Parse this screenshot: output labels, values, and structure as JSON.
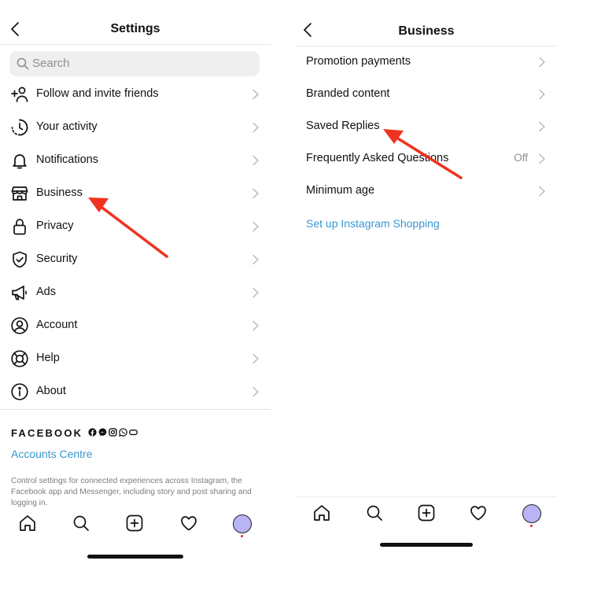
{
  "left": {
    "title": "Settings",
    "search_placeholder": "Search",
    "items": [
      {
        "label": "Follow and invite friends",
        "icon": "add-person-icon"
      },
      {
        "label": "Your activity",
        "icon": "activity-clock-icon"
      },
      {
        "label": "Notifications",
        "icon": "bell-icon"
      },
      {
        "label": "Business",
        "icon": "shop-icon"
      },
      {
        "label": "Privacy",
        "icon": "lock-icon"
      },
      {
        "label": "Security",
        "icon": "shield-check-icon"
      },
      {
        "label": "Ads",
        "icon": "megaphone-icon"
      },
      {
        "label": "Account",
        "icon": "person-circle-icon"
      },
      {
        "label": "Help",
        "icon": "lifebuoy-icon"
      },
      {
        "label": "About",
        "icon": "info-icon"
      }
    ],
    "facebook_wordmark": "FACEBOOK",
    "facebook_brand_icons": [
      "facebook-icon",
      "messenger-icon",
      "instagram-icon",
      "whatsapp-icon",
      "portal-icon"
    ],
    "accounts_centre_label": "Accounts Centre",
    "accounts_description": "Control settings for connected experiences across Instagram, the Facebook app and Messenger, including story and post sharing and logging in."
  },
  "right": {
    "title": "Business",
    "items": [
      {
        "label": "Promotion payments",
        "value": ""
      },
      {
        "label": "Branded content",
        "value": ""
      },
      {
        "label": "Saved Replies",
        "value": ""
      },
      {
        "label": "Frequently Asked Questions",
        "value": "Off"
      },
      {
        "label": "Minimum age",
        "value": ""
      }
    ],
    "shopping_link": "Set up Instagram Shopping"
  },
  "tabbar_icons": [
    "home-icon",
    "search-icon",
    "create-icon",
    "heart-icon",
    "profile-avatar"
  ],
  "colors": {
    "link": "#3897cf",
    "annotation_arrow": "#f0331f",
    "avatar": "#b9b4f5",
    "notification_dot": "#f0204a",
    "search_background": "#efefef"
  }
}
